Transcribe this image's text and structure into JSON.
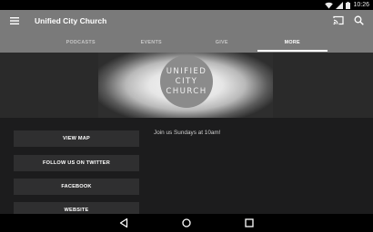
{
  "status_bar": {
    "time": "10:26",
    "icons": [
      "wifi-icon",
      "signal-icon",
      "battery-icon"
    ]
  },
  "app_bar": {
    "title": "Unified City Church",
    "icons": [
      "menu-icon",
      "cast-icon",
      "search-icon"
    ],
    "background": "#7a7a7a"
  },
  "tabs": [
    {
      "label": "PODCASTS",
      "active": false
    },
    {
      "label": "EVENTS",
      "active": false
    },
    {
      "label": "GIVE",
      "active": false
    },
    {
      "label": "MORE",
      "active": true
    }
  ],
  "banner": {
    "logo_lines": [
      "UNIFIED",
      "CITY",
      "CHURCH"
    ]
  },
  "content": {
    "buttons": [
      {
        "label": "VIEW MAP"
      },
      {
        "label": "FOLLOW US ON TWITTER"
      },
      {
        "label": "FACEBOOK"
      },
      {
        "label": "WEBSITE"
      }
    ],
    "note": "Join us Sundays at 10am!"
  },
  "nav_bar": {
    "icons": [
      "back-icon",
      "home-icon",
      "recents-icon"
    ]
  },
  "colors": {
    "status_bar": "#000000",
    "content_background": "#1c1c1d",
    "button_background": "#2f2f30"
  }
}
